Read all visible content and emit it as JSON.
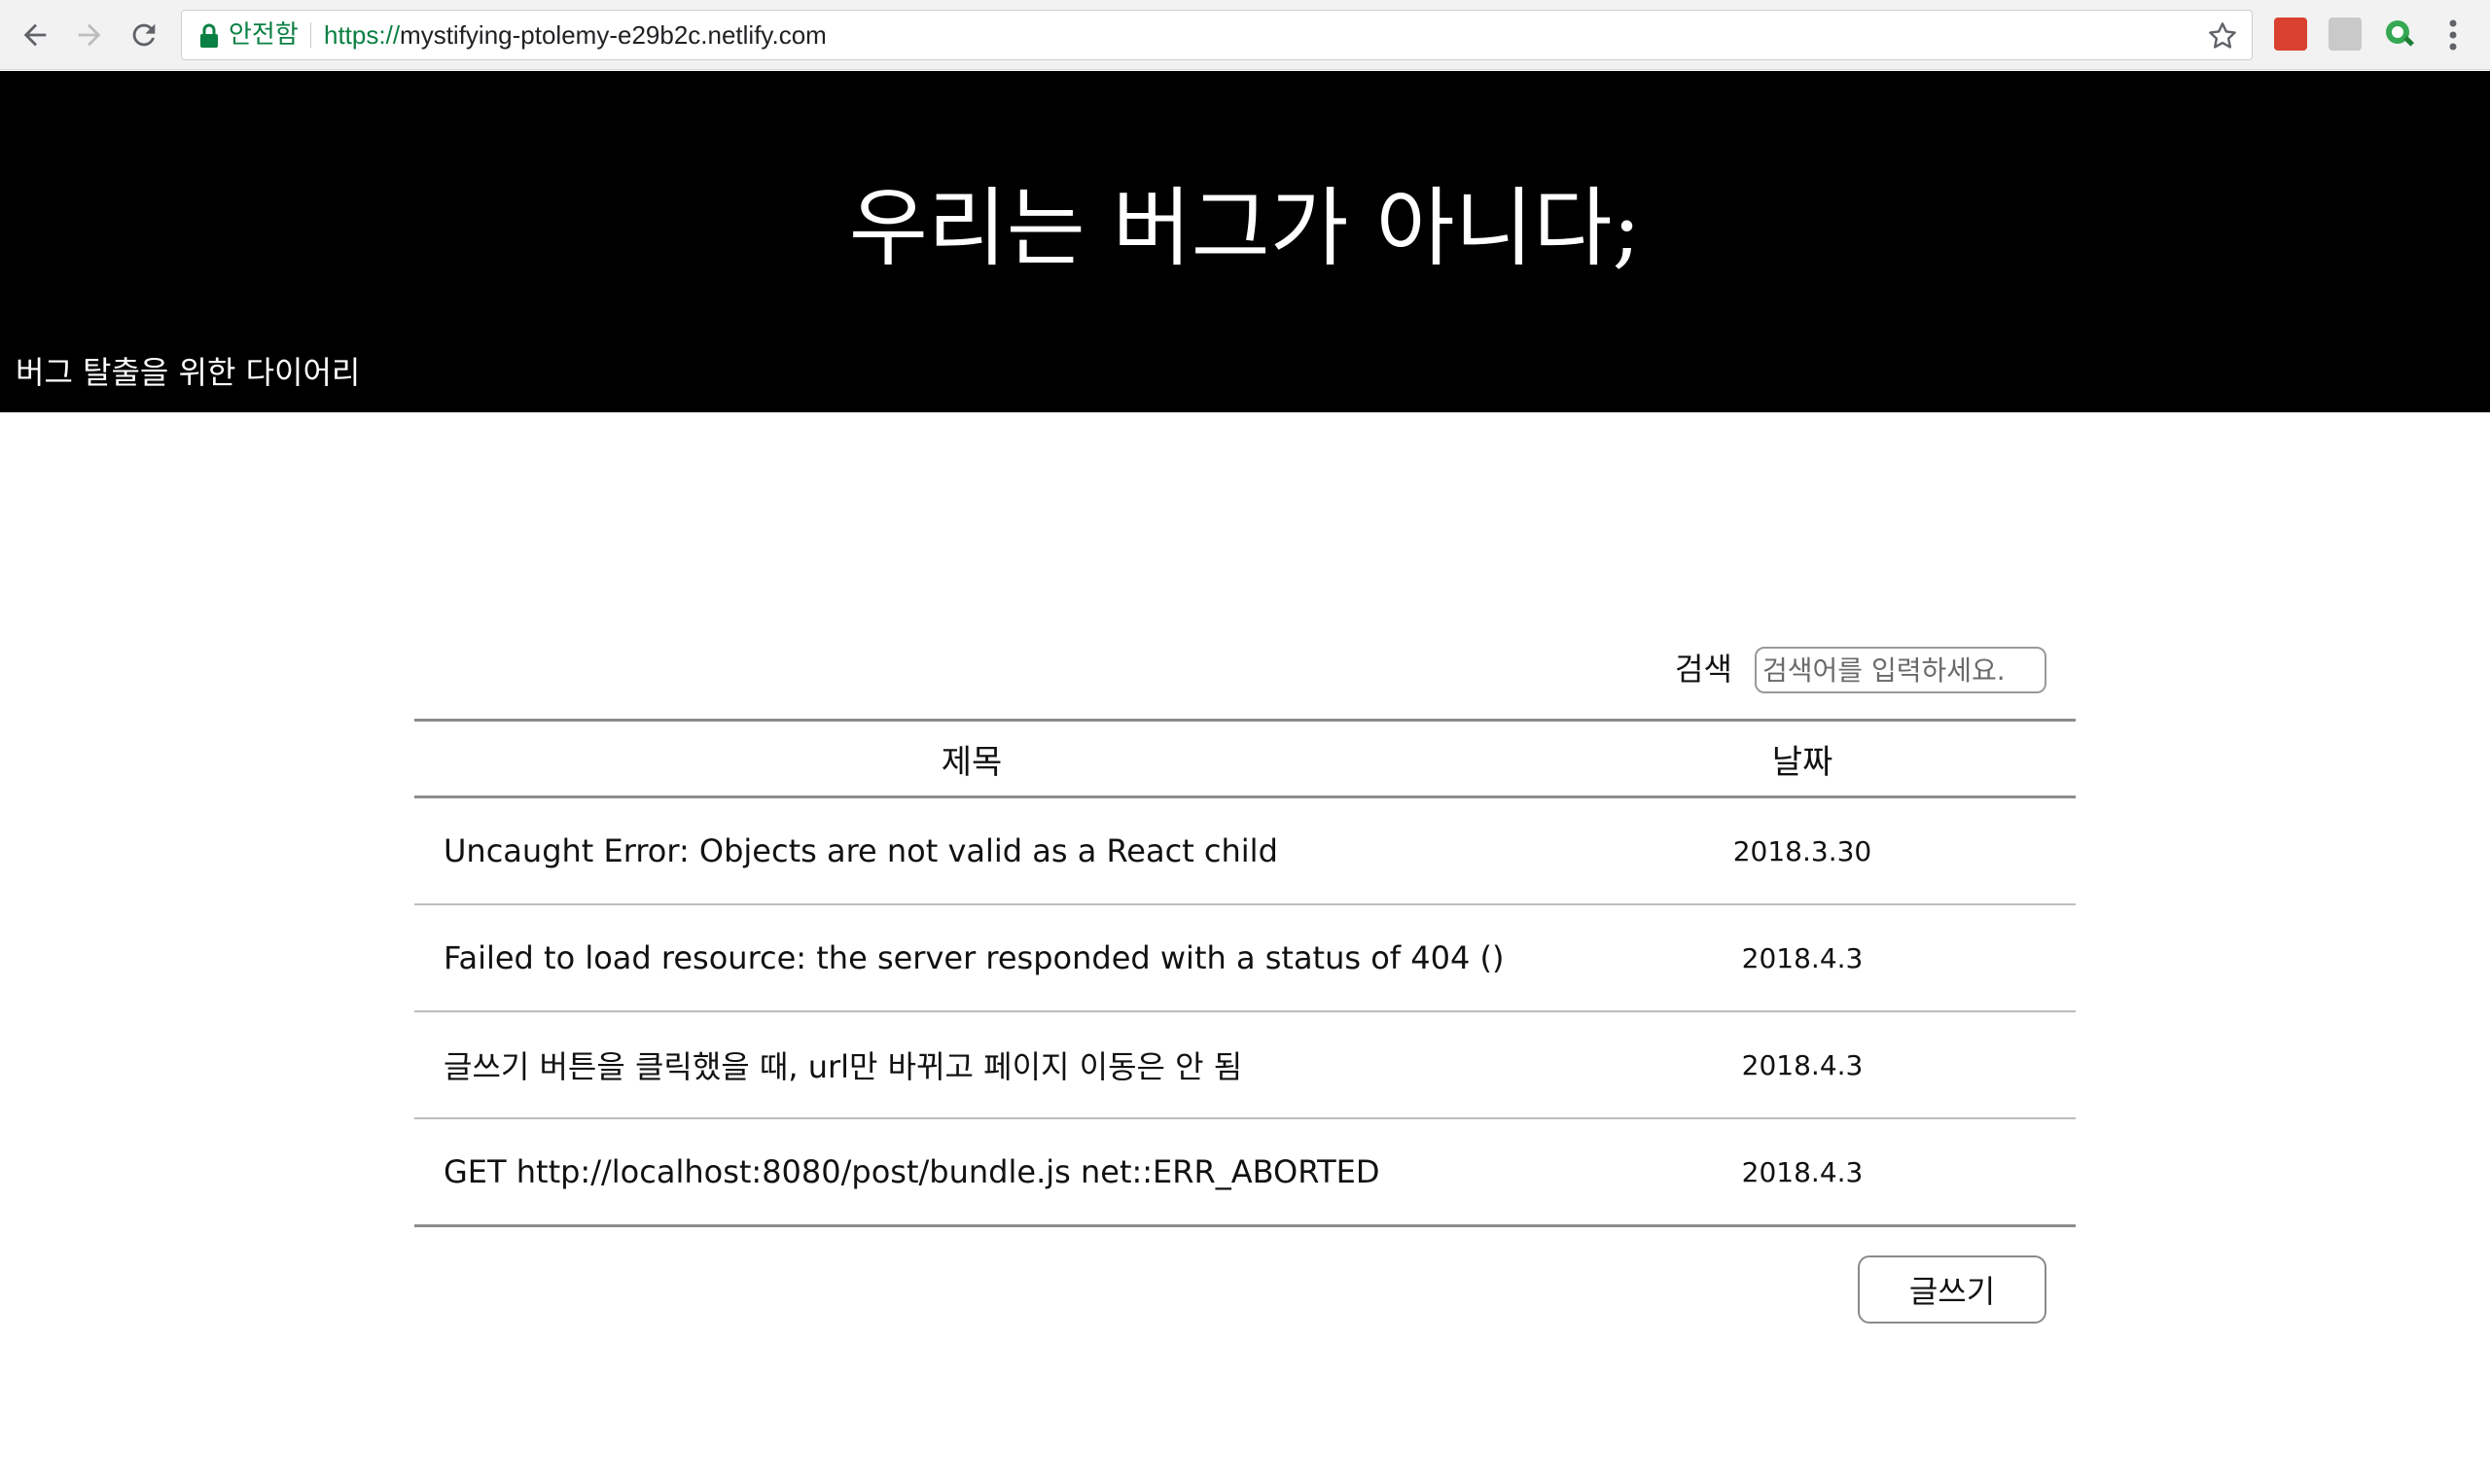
{
  "browser": {
    "secure_label": "안전함",
    "url_scheme": "https://",
    "url_host": "mystifying-ptolemy-e29b2c.netlify.com",
    "icons": [
      "back-icon",
      "forward-icon",
      "reload-icon",
      "lock-icon",
      "star-icon",
      "extension-icon",
      "menu-dots-icon"
    ],
    "colors": {
      "secure": "#0b8043",
      "toolbar_bg": "#f2f2f2"
    }
  },
  "header": {
    "title": "우리는 버그가 아니다;",
    "subtitle": "버그 탈출을 위한 다이어리",
    "bg_color": "#000000"
  },
  "search": {
    "label": "검색",
    "placeholder": "검색어를 입력하세요."
  },
  "table": {
    "columns": [
      "제목",
      "날짜"
    ],
    "rows": [
      {
        "title": "Uncaught Error: Objects are not valid as a React child",
        "date": "2018.3.30"
      },
      {
        "title": "Failed to load resource: the server responded with a status of 404 ()",
        "date": "2018.4.3"
      },
      {
        "title": "글쓰기 버튼을 클릭했을 때, url만 바뀌고 페이지 이동은 안 됨",
        "date": "2018.4.3"
      },
      {
        "title": "GET http://localhost:8080/post/bundle.js net::ERR_ABORTED",
        "date": "2018.4.3"
      }
    ]
  },
  "write_button": {
    "label": "글쓰기"
  }
}
